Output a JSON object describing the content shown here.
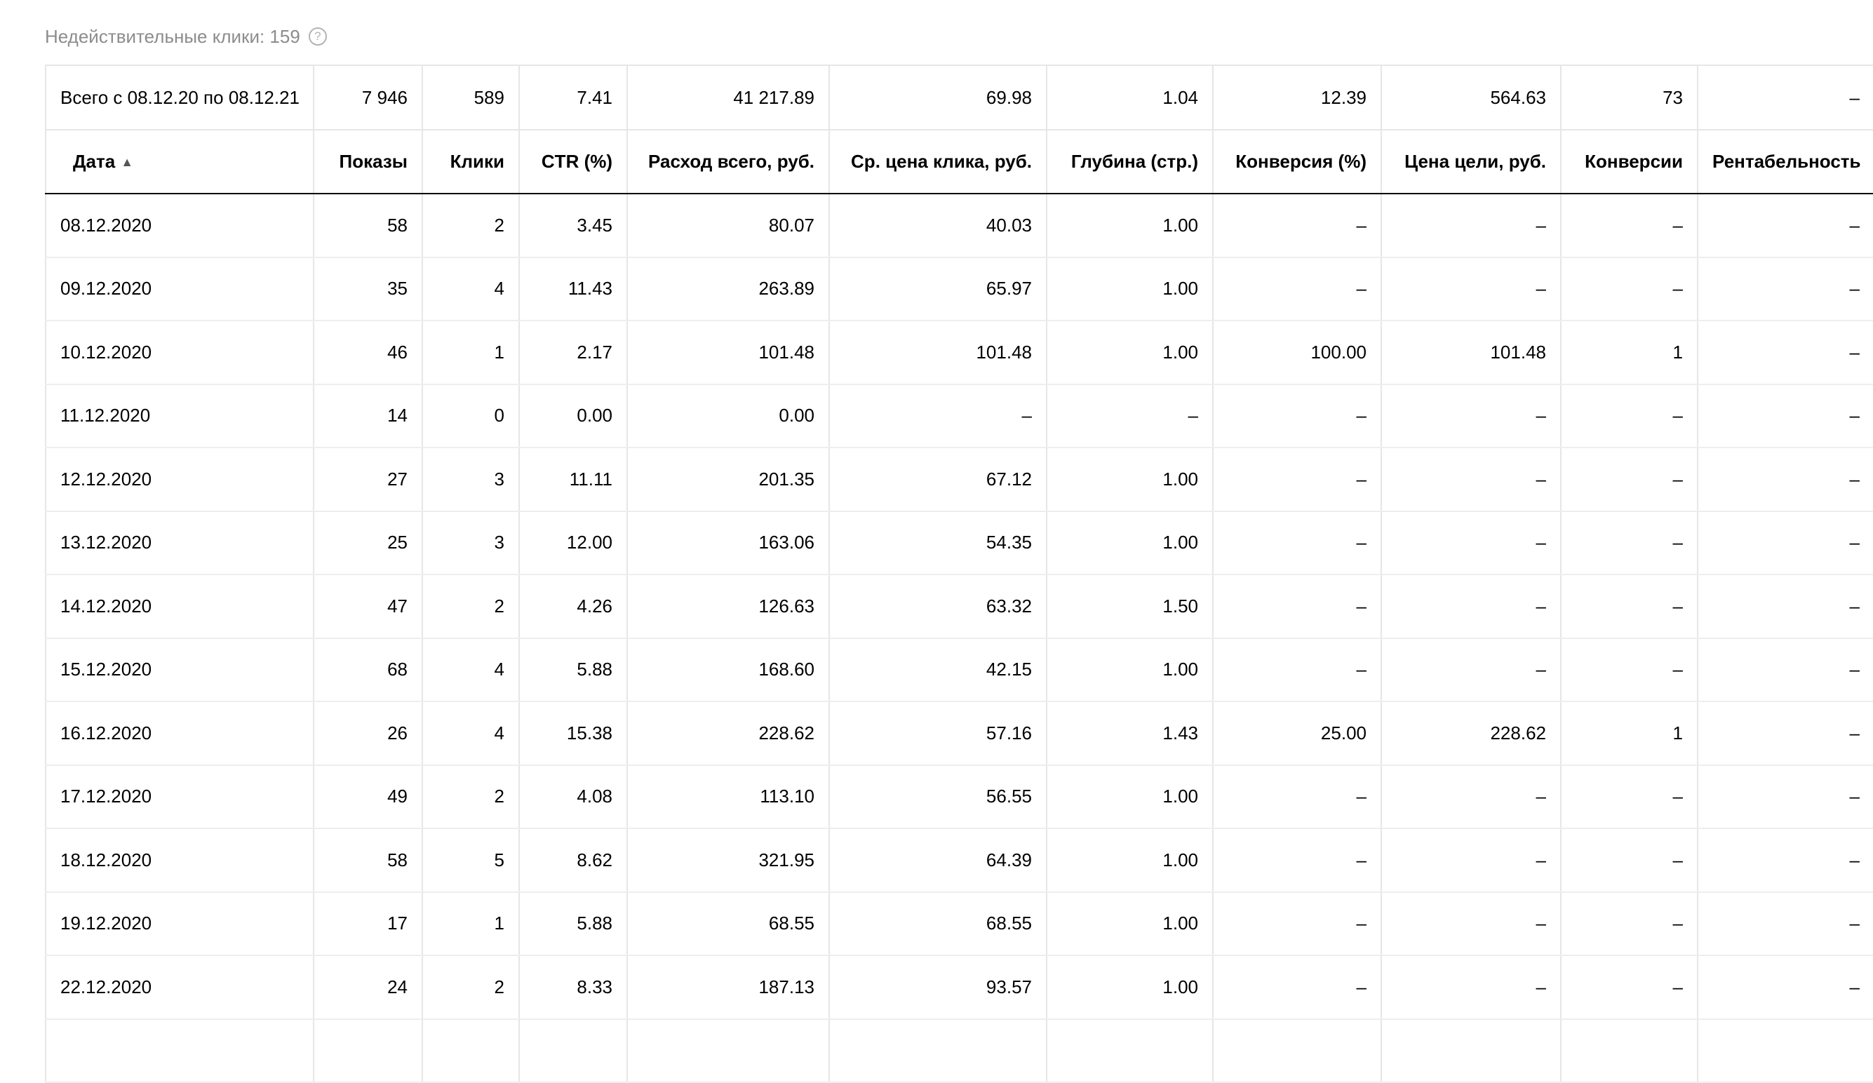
{
  "invalid_clicks": {
    "label": "Недействительные клики: 159",
    "help_icon": "question-circle-icon",
    "help_glyph": "?"
  },
  "totals": {
    "label": "Всего с 08.12.20 по 08.12.21",
    "values": [
      "7 946",
      "589",
      "7.41",
      "41 217.89",
      "69.98",
      "1.04",
      "12.39",
      "564.63",
      "73",
      "–"
    ]
  },
  "columns": [
    {
      "key": "date",
      "label": "Дата",
      "sort": "ascending",
      "sort_icon": "sort-up-icon",
      "sort_glyph": "▲"
    },
    {
      "key": "impressions",
      "label": "Показы"
    },
    {
      "key": "clicks",
      "label": "Клики"
    },
    {
      "key": "ctr",
      "label": "CTR (%)"
    },
    {
      "key": "spend",
      "label": "Расход всего, руб."
    },
    {
      "key": "avg_cpc",
      "label": "Ср. цена клика, руб."
    },
    {
      "key": "depth",
      "label": "Глубина (стр.)"
    },
    {
      "key": "conversion_rate",
      "label": "Конверсия (%)"
    },
    {
      "key": "goal_price",
      "label": "Цена цели, руб."
    },
    {
      "key": "conversions",
      "label": "Конверсии"
    },
    {
      "key": "profitability",
      "label": "Рентабельность"
    }
  ],
  "rows": [
    [
      "08.12.2020",
      "58",
      "2",
      "3.45",
      "80.07",
      "40.03",
      "1.00",
      "–",
      "–",
      "–",
      "–"
    ],
    [
      "09.12.2020",
      "35",
      "4",
      "11.43",
      "263.89",
      "65.97",
      "1.00",
      "–",
      "–",
      "–",
      "–"
    ],
    [
      "10.12.2020",
      "46",
      "1",
      "2.17",
      "101.48",
      "101.48",
      "1.00",
      "100.00",
      "101.48",
      "1",
      "–"
    ],
    [
      "11.12.2020",
      "14",
      "0",
      "0.00",
      "0.00",
      "–",
      "–",
      "–",
      "–",
      "–",
      "–"
    ],
    [
      "12.12.2020",
      "27",
      "3",
      "11.11",
      "201.35",
      "67.12",
      "1.00",
      "–",
      "–",
      "–",
      "–"
    ],
    [
      "13.12.2020",
      "25",
      "3",
      "12.00",
      "163.06",
      "54.35",
      "1.00",
      "–",
      "–",
      "–",
      "–"
    ],
    [
      "14.12.2020",
      "47",
      "2",
      "4.26",
      "126.63",
      "63.32",
      "1.50",
      "–",
      "–",
      "–",
      "–"
    ],
    [
      "15.12.2020",
      "68",
      "4",
      "5.88",
      "168.60",
      "42.15",
      "1.00",
      "–",
      "–",
      "–",
      "–"
    ],
    [
      "16.12.2020",
      "26",
      "4",
      "15.38",
      "228.62",
      "57.16",
      "1.43",
      "25.00",
      "228.62",
      "1",
      "–"
    ],
    [
      "17.12.2020",
      "49",
      "2",
      "4.08",
      "113.10",
      "56.55",
      "1.00",
      "–",
      "–",
      "–",
      "–"
    ],
    [
      "18.12.2020",
      "58",
      "5",
      "8.62",
      "321.95",
      "64.39",
      "1.00",
      "–",
      "–",
      "–",
      "–"
    ],
    [
      "19.12.2020",
      "17",
      "1",
      "5.88",
      "68.55",
      "68.55",
      "1.00",
      "–",
      "–",
      "–",
      "–"
    ],
    [
      "22.12.2020",
      "24",
      "2",
      "8.33",
      "187.13",
      "93.57",
      "1.00",
      "–",
      "–",
      "–",
      "–"
    ],
    [
      "",
      "",
      "",
      "",
      "",
      "",
      "",
      "",
      "",
      "",
      ""
    ]
  ]
}
